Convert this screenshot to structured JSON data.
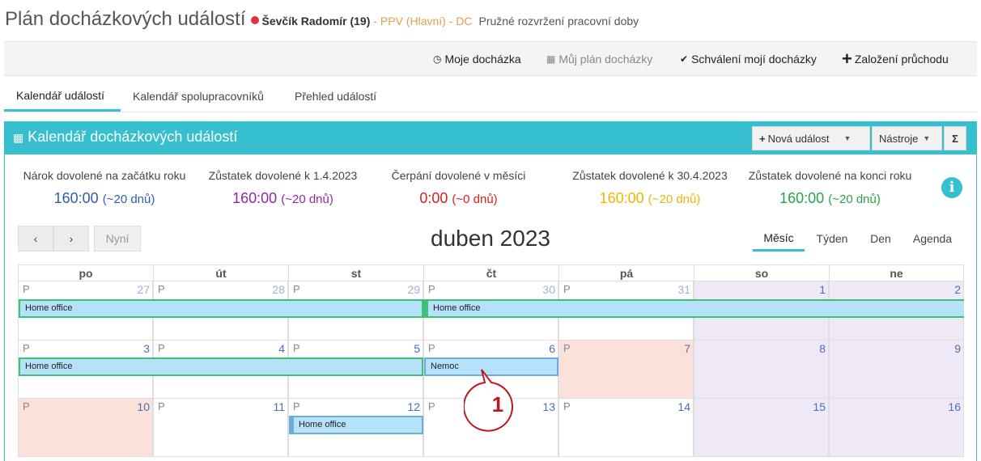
{
  "header": {
    "title": "Plán docházkových událostí",
    "person": "Ševčík Radomír (19)",
    "org": "- PPV (Hlavní) - DC",
    "work_mode": "Pružné rozvržení pracovní doby",
    "status_color": "#e2323e"
  },
  "toolbar": {
    "my_attendance": "Moje docházka",
    "my_plan": "Můj plán docházky",
    "approval": "Schválení mojí docházky",
    "new_pass": "Založení průchodu"
  },
  "tabs": [
    "Kalendář událostí",
    "Kalendář spolupracovníků",
    "Přehled událostí"
  ],
  "panel": {
    "title": "Kalendář docházkových událostí",
    "new_event": "Nová událost",
    "tools": "Nástroje",
    "sum": "Σ",
    "accent": "#36c0cf"
  },
  "stats": [
    {
      "label": "Nárok dovolené na začátku roku",
      "hours": "160:00",
      "days": "(~20 dnů)",
      "color": "#2f5db0"
    },
    {
      "label": "Zůstatek dovolené k 1.4.2023",
      "hours": "160:00",
      "days": "(~20 dnů)",
      "color": "#8e2a9e"
    },
    {
      "label": "Čerpání dovolené v měsíci",
      "hours": "0:00",
      "days": "(~0 dnů)",
      "color": "#d62020"
    },
    {
      "label": "Zůstatek dovolené k 30.4.2023",
      "hours": "160:00",
      "days": "(~20 dnů)",
      "color": "#f0b400"
    },
    {
      "label": "Zůstatek dovolené na konci roku",
      "hours": "160:00",
      "days": "(~20 dnů)",
      "color": "#27a34a"
    }
  ],
  "calendar_nav": {
    "prev": "‹",
    "next": "›",
    "today": "Nyní",
    "month_title": "duben 2023",
    "views": [
      "Měsíc",
      "Týden",
      "Den",
      "Agenda"
    ],
    "active_view": "Měsíc"
  },
  "weekdays": [
    "po",
    "út",
    "st",
    "čt",
    "pá",
    "so",
    "ne"
  ],
  "weeks": [
    {
      "days": [
        {
          "p": "P",
          "num": "27",
          "other": true
        },
        {
          "p": "P",
          "num": "28",
          "other": true
        },
        {
          "p": "P",
          "num": "29",
          "other": true
        },
        {
          "p": "P",
          "num": "30",
          "other": true
        },
        {
          "p": "P",
          "num": "31",
          "other": true
        },
        {
          "p": "",
          "num": "1",
          "weekend": true
        },
        {
          "p": "",
          "num": "2",
          "weekend": true
        }
      ],
      "events": [
        {
          "label": "Home office"
        },
        {
          "label": "Home office"
        }
      ]
    },
    {
      "days": [
        {
          "p": "P",
          "num": "3"
        },
        {
          "p": "P",
          "num": "4"
        },
        {
          "p": "P",
          "num": "5"
        },
        {
          "p": "P",
          "num": "6"
        },
        {
          "p": "P",
          "num": "7",
          "holiday": true
        },
        {
          "p": "",
          "num": "8",
          "weekend": true
        },
        {
          "p": "",
          "num": "9",
          "weekend": true
        }
      ],
      "events": [
        {
          "label": "Home office"
        },
        {
          "label": "Nemoc"
        }
      ]
    },
    {
      "days": [
        {
          "p": "P",
          "num": "10",
          "holiday": true
        },
        {
          "p": "P",
          "num": "11"
        },
        {
          "p": "P",
          "num": "12"
        },
        {
          "p": "P",
          "num": "13"
        },
        {
          "p": "P",
          "num": "14"
        },
        {
          "p": "",
          "num": "15",
          "weekend": true
        },
        {
          "p": "",
          "num": "16",
          "weekend": true
        }
      ],
      "events": [
        {
          "label": "Home office"
        }
      ]
    }
  ],
  "callout": {
    "number": "1",
    "color": "#c0161d"
  }
}
